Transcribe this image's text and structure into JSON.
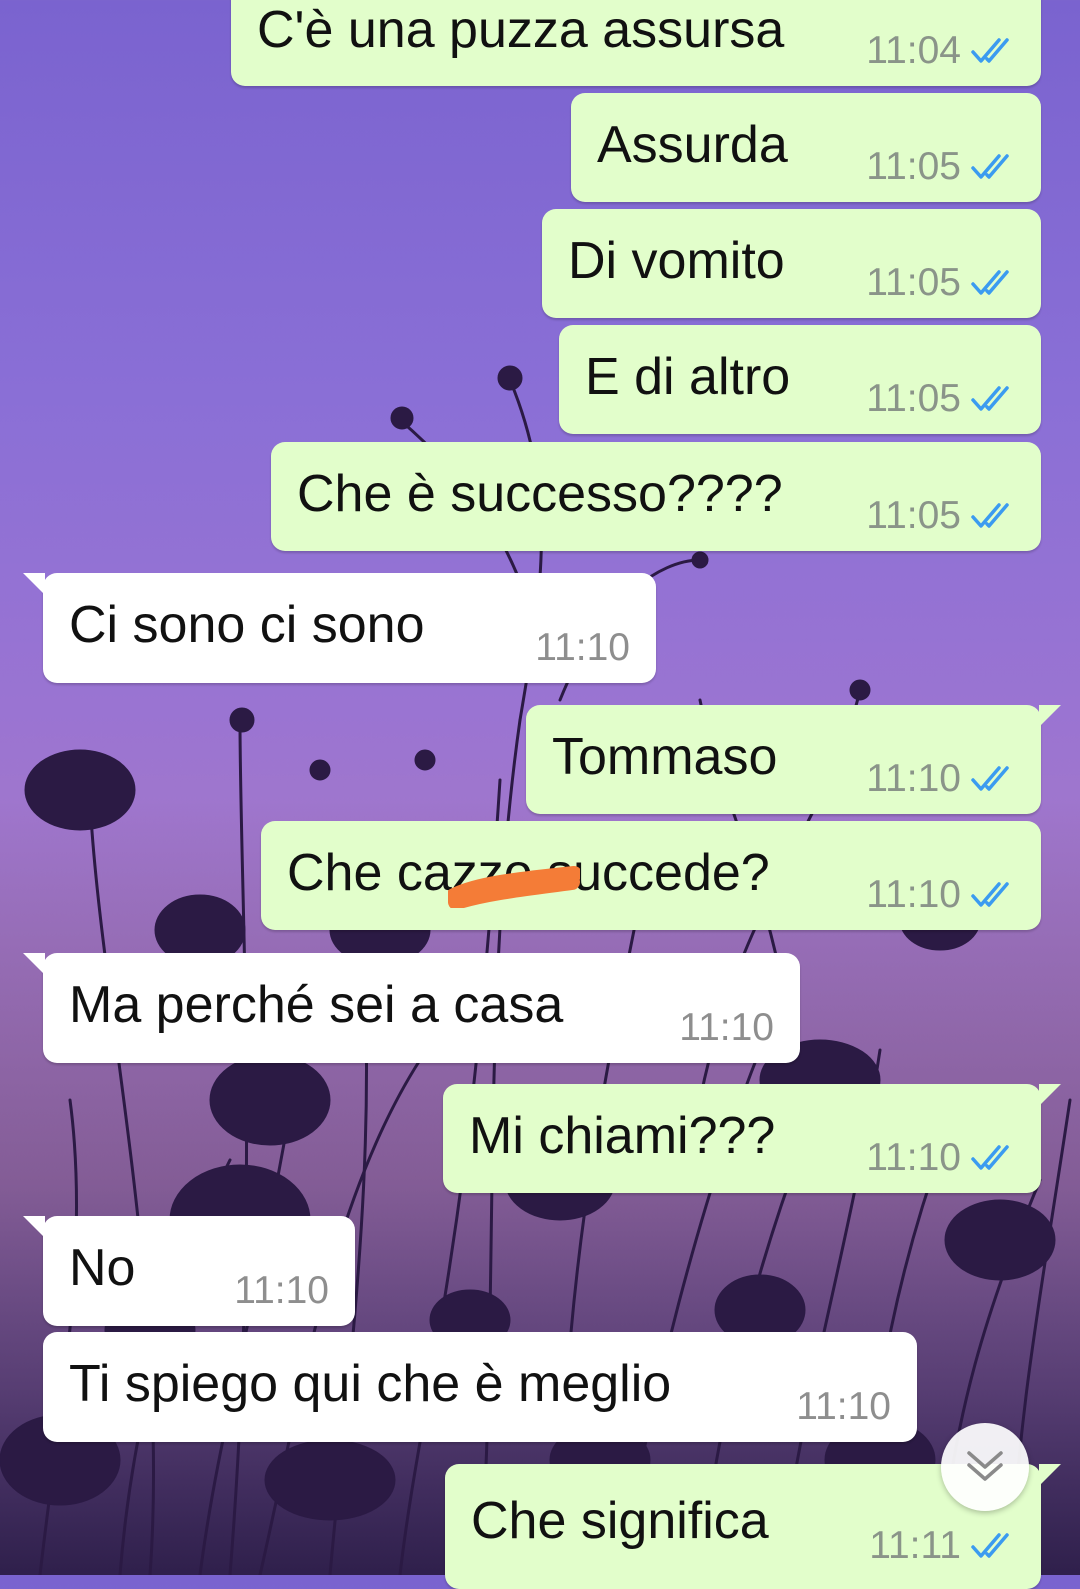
{
  "colors": {
    "outgoing_bubble": "#e2fecb",
    "incoming_bubble": "#ffffff",
    "read_ticks": "#3b9bf0",
    "redaction_mark": "#f47c37"
  },
  "messages": [
    {
      "direction": "out",
      "text": "C'è una puzza assursa",
      "time": "11:04",
      "status": "read"
    },
    {
      "direction": "out",
      "text": "Assurda",
      "time": "11:05",
      "status": "read"
    },
    {
      "direction": "out",
      "text": "Di vomito",
      "time": "11:05",
      "status": "read"
    },
    {
      "direction": "out",
      "text": "E di altro",
      "time": "11:05",
      "status": "read"
    },
    {
      "direction": "out",
      "text": "Che è successo????",
      "time": "11:05",
      "status": "read"
    },
    {
      "direction": "in",
      "text": "Ci sono ci sono",
      "time": "11:10"
    },
    {
      "direction": "out",
      "text": "Tommaso",
      "time": "11:10",
      "status": "read"
    },
    {
      "direction": "out",
      "text": "Che cazzo succede?",
      "time": "11:10",
      "status": "read",
      "redacted": true
    },
    {
      "direction": "in",
      "text": "Ma perché sei a casa",
      "time": "11:10"
    },
    {
      "direction": "out",
      "text": "Mi chiami???",
      "time": "11:10",
      "status": "read"
    },
    {
      "direction": "in",
      "text": "No",
      "time": "11:10"
    },
    {
      "direction": "in",
      "text": "Ti spiego qui che è meglio",
      "time": "11:10"
    },
    {
      "direction": "out",
      "text": "Che significa",
      "time": "11:11",
      "status": "read"
    }
  ],
  "scroll_button": {
    "icon": "double-chevron-down-icon"
  }
}
